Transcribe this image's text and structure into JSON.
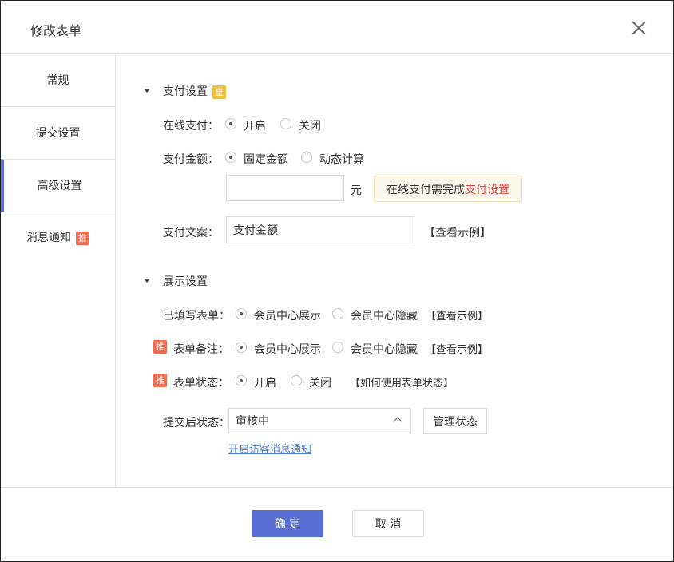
{
  "dialog": {
    "title": "修改表单"
  },
  "sidebar": {
    "items": [
      {
        "label": "常规"
      },
      {
        "label": "提交设置"
      },
      {
        "label": "高级设置"
      },
      {
        "label": "消息通知",
        "badge": "推"
      }
    ]
  },
  "payment": {
    "section_title": "支付设置",
    "section_badge": "皇",
    "online_label": "在线支付：",
    "online_options": [
      "开启",
      "关闭"
    ],
    "online_selected": "开启",
    "amount_label": "支付金额：",
    "amount_options": [
      "固定金额",
      "动态计算"
    ],
    "amount_selected": "固定金额",
    "amount_value": "",
    "amount_unit": "元",
    "tip_prefix": "在线支付需完成",
    "tip_link": "支付设置",
    "copy_label": "支付文案：",
    "copy_value": "支付金额",
    "copy_example": "【查看示例】"
  },
  "display": {
    "section_title": "展示设置",
    "filled_label": "已填写表单：",
    "filled_options": [
      "会员中心展示",
      "会员中心隐藏"
    ],
    "filled_selected": "会员中心展示",
    "filled_example": "【查看示例】",
    "remark_badge": "推",
    "remark_label": "表单备注：",
    "remark_options": [
      "会员中心展示",
      "会员中心隐藏"
    ],
    "remark_selected": "会员中心展示",
    "remark_example": "【查看示例】",
    "status_badge": "推",
    "status_label": "表单状态：",
    "status_options": [
      "开启",
      "关闭"
    ],
    "status_selected": "开启",
    "status_help": "【如何使用表单状态】",
    "after_label": "提交后状态：",
    "after_value": "审核中",
    "manage_button": "管理状态",
    "visitor_link": "开启访客消息通知"
  },
  "footer": {
    "confirm": "确 定",
    "cancel": "取 消"
  },
  "colors": {
    "primary": "#5a6fd3",
    "badge_orange": "#ee6b4d",
    "badge_yellow": "#f5be3a",
    "link": "#4a7ce0",
    "tip_link": "#e0433e"
  }
}
